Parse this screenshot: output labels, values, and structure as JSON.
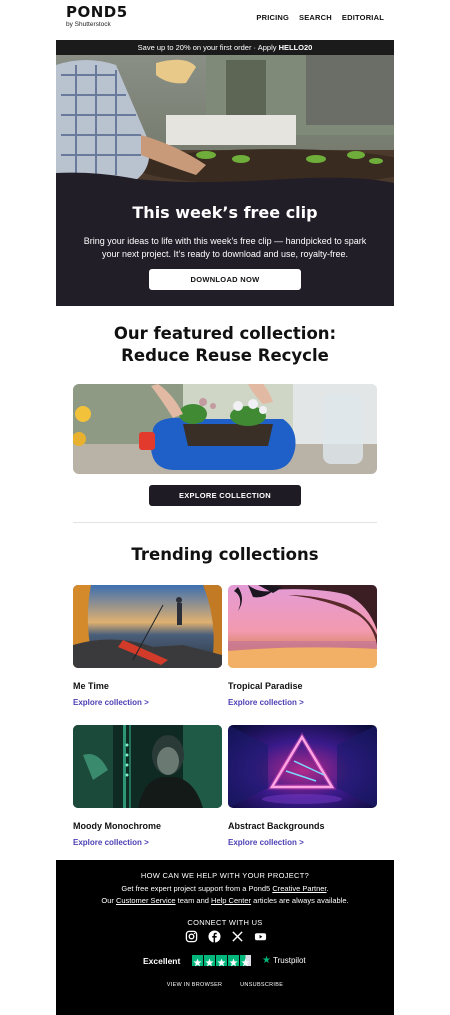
{
  "header": {
    "logo": "POND5",
    "logo_sub": "by Shutterstock",
    "nav": [
      "PRICING",
      "SEARCH",
      "EDITORIAL"
    ]
  },
  "promo": {
    "text": "Save up to 20% on your first order · Apply ",
    "code": "HELLO20"
  },
  "hero": {
    "title": "This week’s free clip",
    "description": "Bring your ideas to life with this week’s free clip — handpicked to spark your next project. It’s ready to download and use, royalty-free.",
    "button": "DOWNLOAD NOW"
  },
  "featured": {
    "title_line1": "Our featured collection:",
    "title_line2": "Reduce Reuse Recycle",
    "button": "EXPLORE COLLECTION"
  },
  "trending": {
    "title": "Trending collections",
    "cards": [
      {
        "title": "Me Time",
        "link": "Explore collection >"
      },
      {
        "title": "Tropical Paradise",
        "link": "Explore collection >"
      },
      {
        "title": "Moody Monochrome",
        "link": "Explore collection >"
      },
      {
        "title": "Abstract Backgrounds",
        "link": "Explore collection >"
      }
    ]
  },
  "footer": {
    "heading": "HOW CAN WE HELP WITH YOUR PROJECT?",
    "line1_pre": "Get free expert project support from a Pond5 ",
    "line1_link": "Creative Partner",
    "line1_post": ".",
    "line2_pre": "Our ",
    "line2_link1": "Customer Service",
    "line2_mid": " team and ",
    "line2_link2": "Help Center",
    "line2_post": " articles are always available.",
    "connect": "CONNECT WITH US",
    "social_icons": [
      "instagram-icon",
      "facebook-icon",
      "x-icon",
      "youtube-icon"
    ],
    "trustpilot_label": "Excellent",
    "trustpilot_stars": 4.5,
    "trustpilot_brand": "Trustpilot",
    "links": [
      "VIEW IN BROWSER",
      "UNSUBSCRIBE"
    ]
  },
  "colors": {
    "hero_bg": "#211e28",
    "link": "#4b3fb3",
    "trustpilot_green": "#00b67a"
  }
}
